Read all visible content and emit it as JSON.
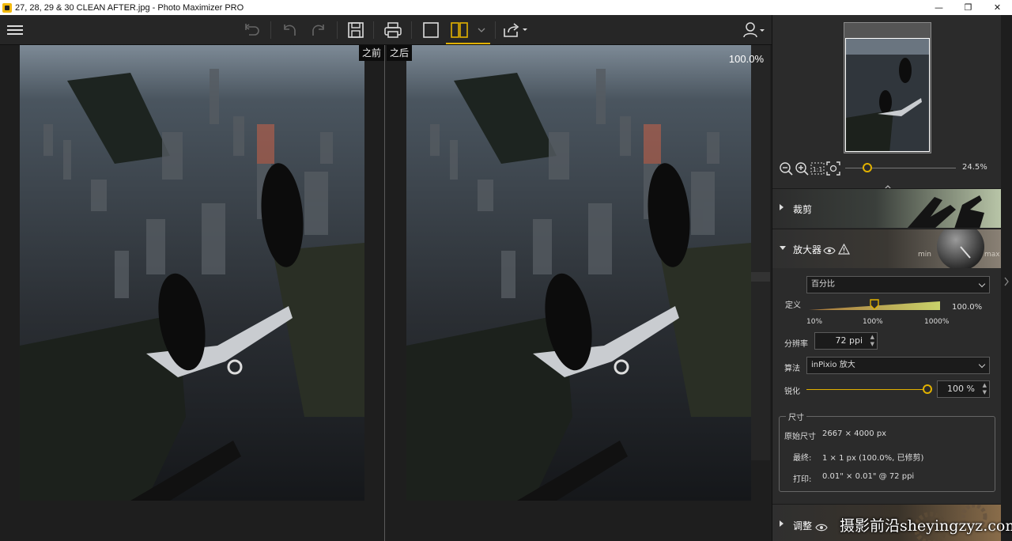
{
  "window": {
    "title": "27, 28, 29 & 30 CLEAN AFTER.jpg - Photo Maximizer PRO",
    "min_glyph": "—",
    "max_glyph": "❐",
    "close_glyph": "✕"
  },
  "toolbar": {
    "icons": [
      "menu-icon",
      "undo-all-icon",
      "undo-icon",
      "redo-icon",
      "save-icon",
      "print-icon",
      "single-view-icon",
      "split-view-icon",
      "view-dropdown-icon",
      "share-icon",
      "user-icon"
    ],
    "accent": "#e1b100"
  },
  "tooltips": {
    "before": "之前",
    "after": "之后"
  },
  "viewer": {
    "zoom_label": "100.0%"
  },
  "navigator": {
    "zoom_value": "24.5%",
    "zoom_level": 0.2
  },
  "sections": {
    "crop": {
      "label": "裁剪"
    },
    "enlarger": {
      "label": "放大器"
    },
    "adjust": {
      "label": "调整"
    }
  },
  "enlarger": {
    "mode_value": "百分比",
    "definition_label": "定义",
    "definition_value": "100.0%",
    "definition_level": 0.5,
    "scale_ticks": [
      "10%",
      "100%",
      "1000%"
    ],
    "resolution_label": "分辨率",
    "resolution_value": "72 ppi",
    "algorithm_label": "算法",
    "algorithm_value": "inPixio 放大",
    "sharpen_label": "锐化",
    "sharpen_value": "100 %",
    "sharpen_level": 1.0
  },
  "size": {
    "legend": "尺寸",
    "original_label": "原始尺寸",
    "original_value": "2667 × 4000 px",
    "final_label": "最终:",
    "final_value": "1 × 1 px (100.0%, 已修剪)",
    "print_label": "打印:",
    "print_value": "0.01\" × 0.01\" @ 72 ppi"
  },
  "watermark": "摄影前沿sheyingzyz.com"
}
